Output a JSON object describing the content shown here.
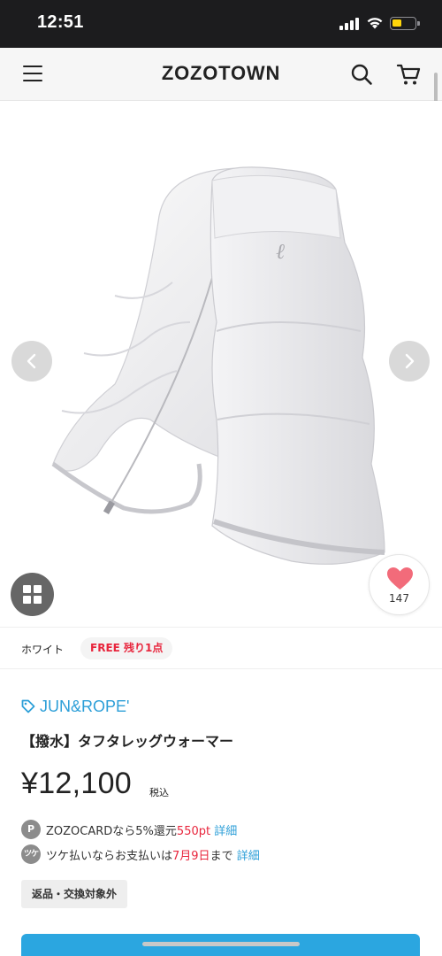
{
  "status_bar": {
    "time": "12:51"
  },
  "header": {
    "logo": "ZOZOTOWN"
  },
  "product": {
    "favorite_count": "147",
    "color_name": "ホワイト",
    "size_stock": "FREE 残り1点",
    "brand": "JUN&ROPE'",
    "title": "【撥水】タフタレッグウォーマー",
    "price": "¥12,100",
    "tax_label": "税込",
    "return_policy": "返品・交換対象外"
  },
  "points": {
    "zozocard": {
      "badge": "P",
      "prefix": "ZOZOCARDなら5%還元",
      "amount": "550pt",
      "link": "詳細"
    },
    "tsuke": {
      "badge": "ツケ",
      "prefix": "ツケ払いならお支払いは",
      "date": "7月9日",
      "suffix": "まで",
      "link": "詳細"
    }
  },
  "colors": {
    "accent_blue": "#2d9fd8",
    "sale_red": "#e8263d",
    "heart_pink": "#f26b7a",
    "header_bg": "#f6f6f6"
  },
  "icons": [
    "menu-icon",
    "search-icon",
    "cart-icon",
    "chevron-left-icon",
    "chevron-right-icon",
    "grid-icon",
    "heart-icon",
    "tag-icon"
  ]
}
